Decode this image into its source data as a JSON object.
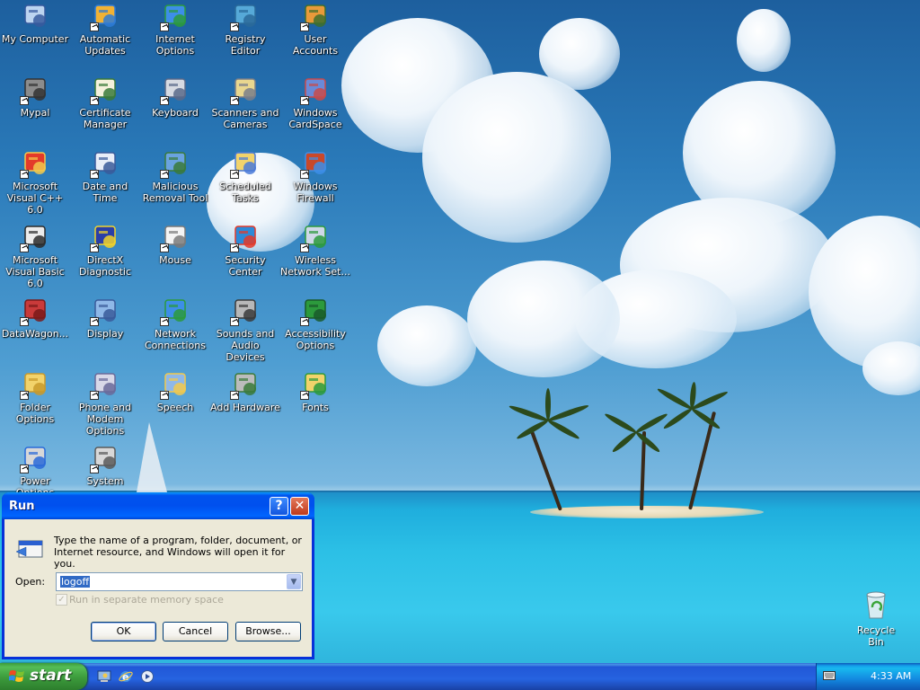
{
  "desktop": {
    "icons": [
      {
        "label": "My Computer",
        "icon": "computer-icon"
      },
      {
        "label": "Automatic Updates",
        "icon": "windows-update-icon"
      },
      {
        "label": "Internet Options",
        "icon": "internet-options-icon"
      },
      {
        "label": "Registry Editor",
        "icon": "registry-icon"
      },
      {
        "label": "User Accounts",
        "icon": "users-icon"
      },
      {
        "label": "Mypal",
        "icon": "raccoon-icon"
      },
      {
        "label": "Certificate Manager",
        "icon": "certificate-icon"
      },
      {
        "label": "Keyboard",
        "icon": "keyboard-icon"
      },
      {
        "label": "Scanners and Cameras",
        "icon": "scanner-icon"
      },
      {
        "label": "Windows CardSpace",
        "icon": "cardspace-icon"
      },
      {
        "label": "Microsoft Visual C++ 6.0",
        "icon": "visual-cpp-icon"
      },
      {
        "label": "Date and Time",
        "icon": "clock-icon"
      },
      {
        "label": "Malicious Removal Tool",
        "icon": "removal-tool-icon"
      },
      {
        "label": "Scheduled Tasks",
        "icon": "scheduled-tasks-icon"
      },
      {
        "label": "Windows Firewall",
        "icon": "firewall-icon"
      },
      {
        "label": "Microsoft Visual Basic 6.0",
        "icon": "visual-basic-icon"
      },
      {
        "label": "DirectX Diagnostic",
        "icon": "directx-icon"
      },
      {
        "label": "Mouse",
        "icon": "mouse-icon"
      },
      {
        "label": "Security Center",
        "icon": "shield-icon"
      },
      {
        "label": "Wireless Network Set...",
        "icon": "wireless-icon"
      },
      {
        "label": "DataWagon...",
        "icon": "datawagon-icon"
      },
      {
        "label": "Display",
        "icon": "display-icon"
      },
      {
        "label": "Network Connections",
        "icon": "network-icon"
      },
      {
        "label": "Sounds and Audio Devices",
        "icon": "speaker-icon"
      },
      {
        "label": "Accessibility Options",
        "icon": "accessibility-icon"
      },
      {
        "label": "Folder Options",
        "icon": "folder-options-icon"
      },
      {
        "label": "Phone and Modem Options",
        "icon": "phone-icon"
      },
      {
        "label": "Speech",
        "icon": "speech-icon"
      },
      {
        "label": "Add Hardware",
        "icon": "add-hardware-icon"
      },
      {
        "label": "Fonts",
        "icon": "fonts-icon"
      },
      {
        "label": "Power Options",
        "icon": "power-icon"
      },
      {
        "label": "System",
        "icon": "system-icon"
      }
    ],
    "recycle_bin": {
      "label": "Recycle Bin",
      "icon": "recycle-bin-icon"
    }
  },
  "run_dialog": {
    "title": "Run",
    "help_button": "?",
    "close_button": "✕",
    "description": "Type the name of a program, folder, document, or Internet resource, and Windows will open it for you.",
    "open_label": "Open:",
    "open_value": "logoff",
    "checkbox_label": "Run in separate memory space",
    "checkbox_checked": true,
    "ok_label": "OK",
    "cancel_label": "Cancel",
    "browse_label": "Browse..."
  },
  "taskbar": {
    "start_label": "start",
    "quick_launch": [
      "show-desktop-icon",
      "internet-explorer-icon",
      "media-player-icon"
    ],
    "clock": "4:33 AM",
    "tray_icon": "keyboard-icon"
  },
  "colors": {
    "taskbar_blue": "#245edb",
    "start_green": "#3c9a3c",
    "titlebar_blue": "#0053ee",
    "dialog_bg": "#ece9d8"
  }
}
